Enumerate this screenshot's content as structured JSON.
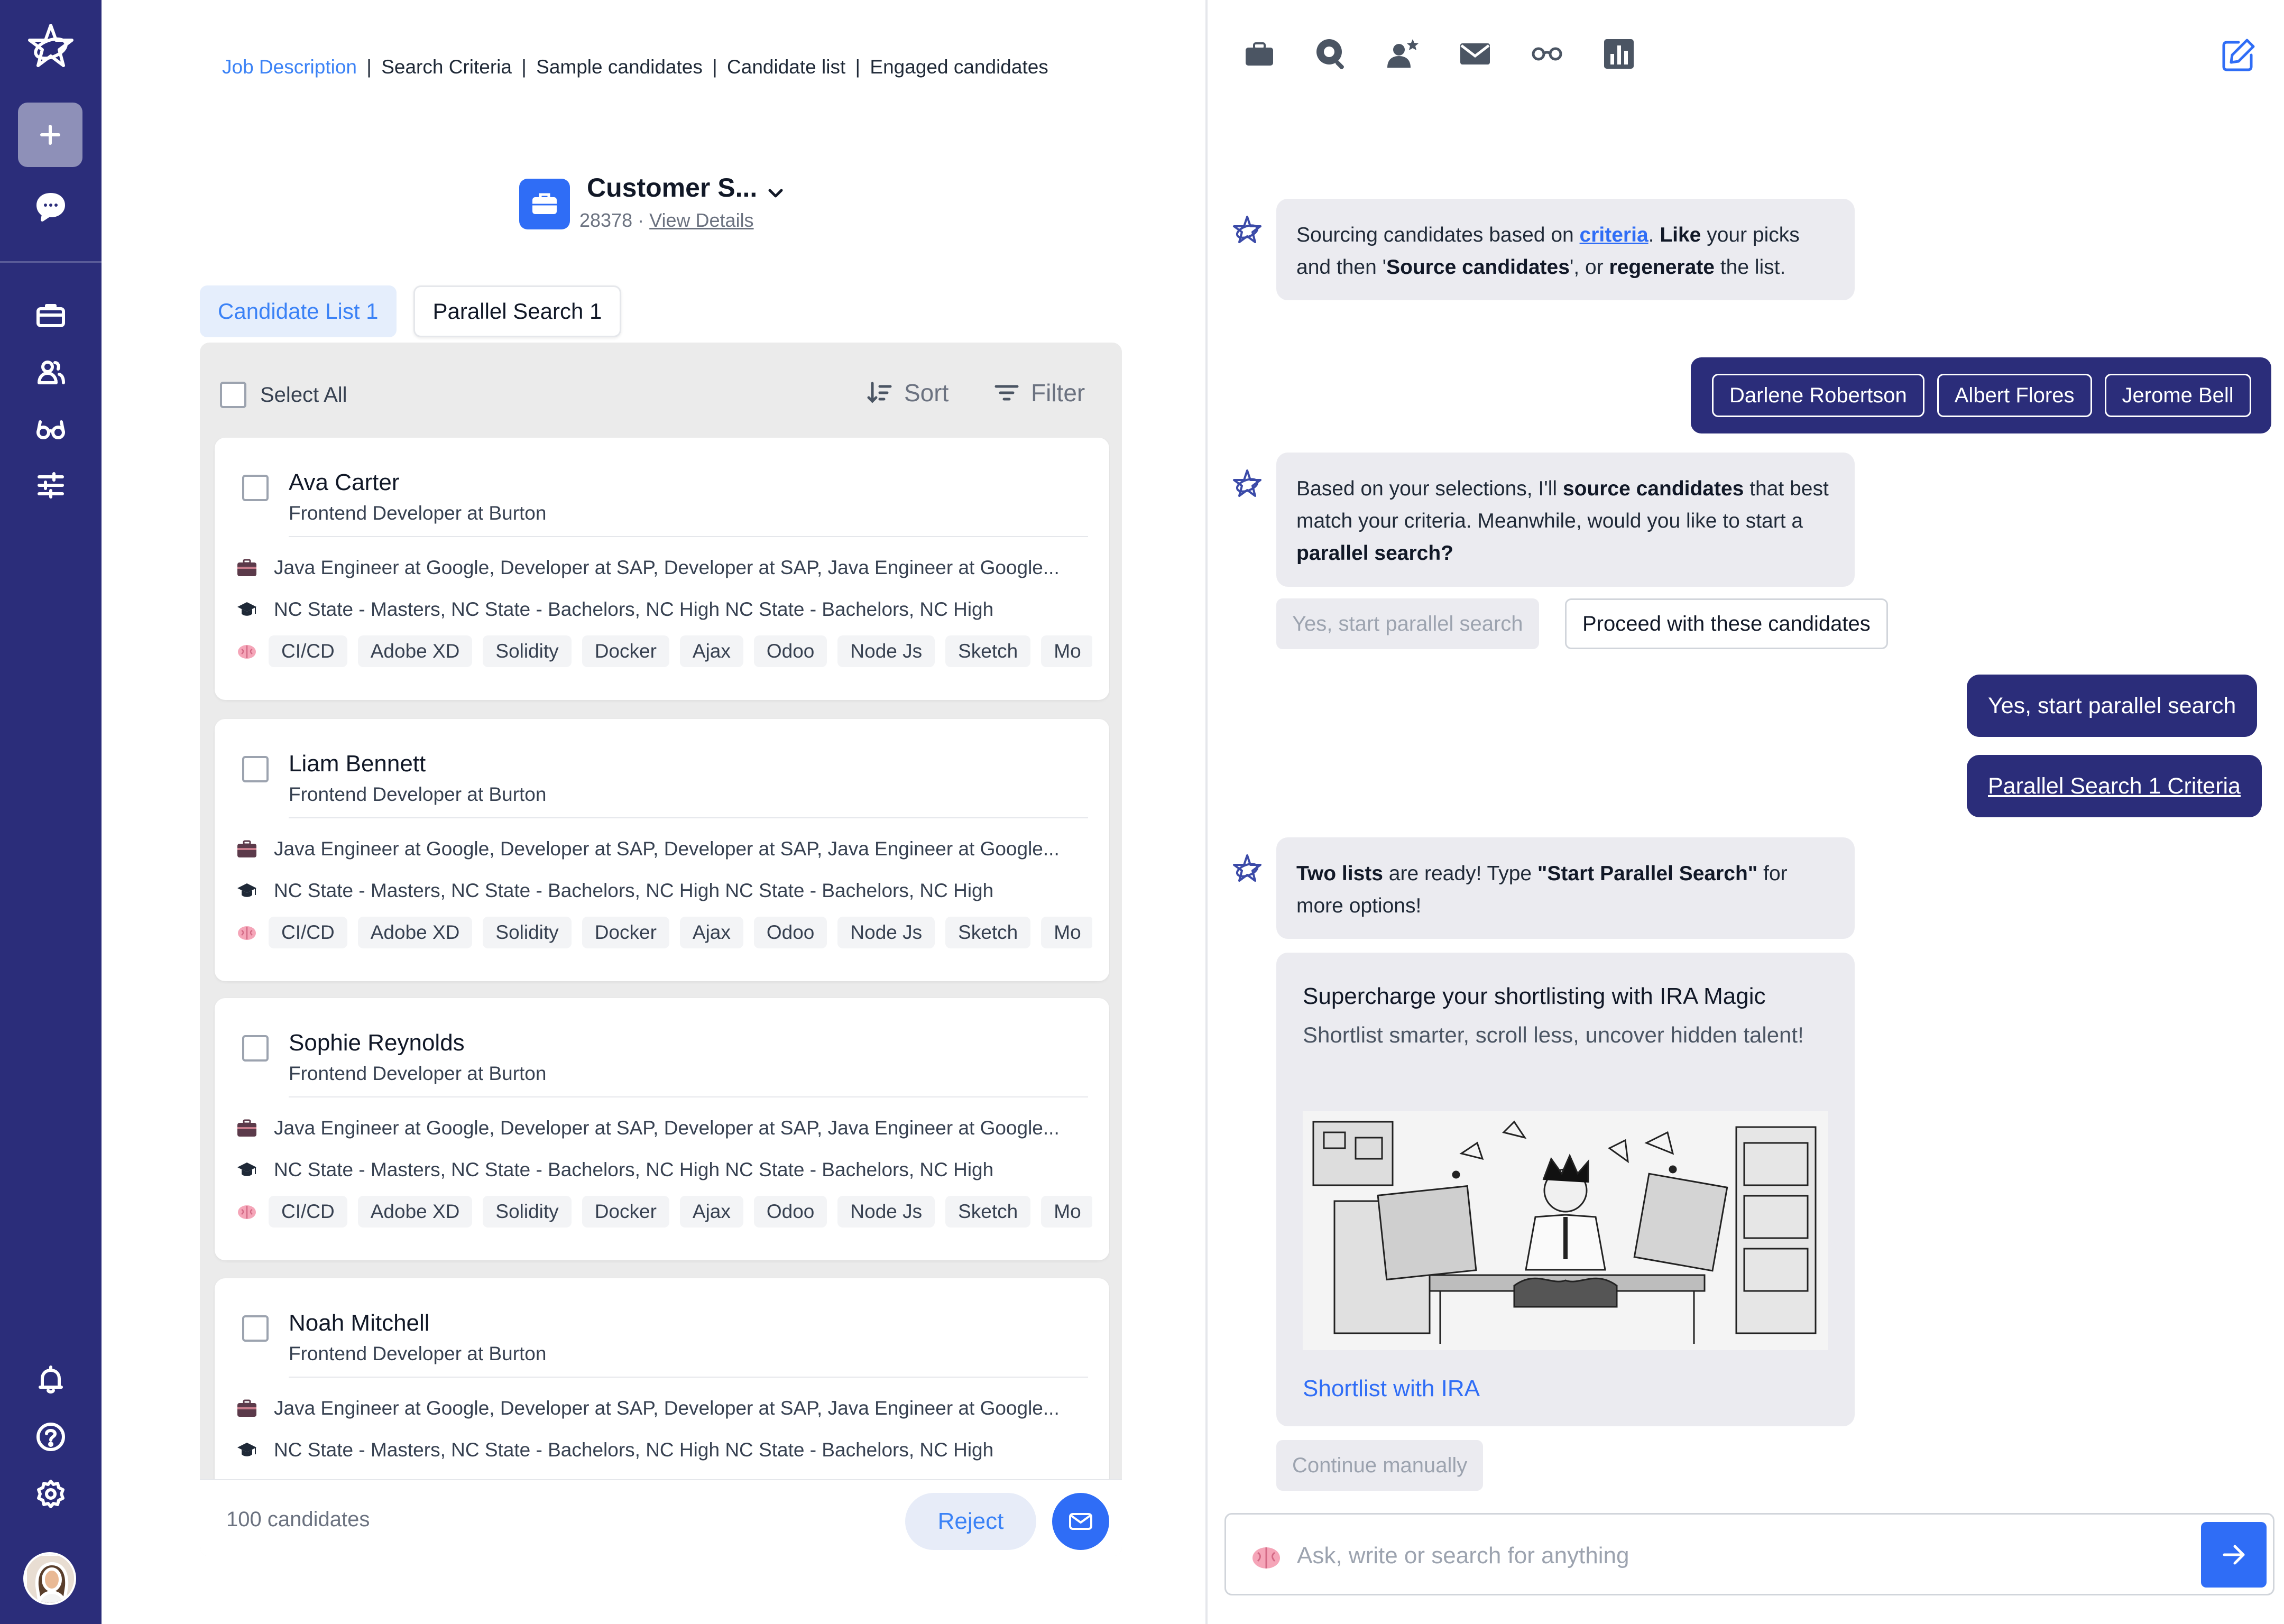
{
  "nav": {
    "items": [
      "logo-icon",
      "new-chat",
      "chat-icon",
      "briefcase-icon",
      "users-icon",
      "glasses-icon",
      "sliders-icon",
      "bell-icon",
      "help-icon",
      "settings-icon",
      "avatar"
    ]
  },
  "breadcrumb": {
    "items": [
      "Job Description",
      "Search Criteria",
      "Sample candidates",
      "Candidate list",
      "Engaged candidates"
    ],
    "active": "Job Description",
    "separator": "|"
  },
  "job": {
    "title": "Customer S...",
    "id": "28378",
    "dot": "·",
    "view_details": "View Details"
  },
  "tabs": {
    "list1": "Candidate List 1",
    "parallel1": "Parallel Search 1"
  },
  "list": {
    "select_all": "Select All",
    "sort": "Sort",
    "filter": "Filter",
    "candidates": [
      {
        "name": "Ava Carter",
        "role": "Frontend Developer at Burton",
        "experience": "Java Engineer at Google,  Developer at SAP,  Developer at SAP,  Java Engineer at Google...",
        "education": "NC State - Masters,  NC State - Bachelors,  NC High NC State - Bachelors,  NC High",
        "skills": [
          "CI/CD",
          "Adobe XD",
          "Solidity",
          "Docker",
          "Ajax",
          "Odoo",
          "Node Js",
          "Sketch",
          "Mo"
        ]
      },
      {
        "name": "Liam Bennett",
        "role": "Frontend Developer at Burton",
        "experience": "Java Engineer at Google,  Developer at SAP,  Developer at SAP,  Java Engineer at Google...",
        "education": "NC State - Masters,  NC State - Bachelors,  NC High NC State - Bachelors,  NC High",
        "skills": [
          "CI/CD",
          "Adobe XD",
          "Solidity",
          "Docker",
          "Ajax",
          "Odoo",
          "Node Js",
          "Sketch",
          "Mo"
        ]
      },
      {
        "name": "Sophie Reynolds",
        "role": "Frontend Developer at Burton",
        "experience": "Java Engineer at Google,  Developer at SAP,  Developer at SAP,  Java Engineer at Google...",
        "education": "NC State - Masters,  NC State - Bachelors,  NC High NC State - Bachelors,  NC High",
        "skills": [
          "CI/CD",
          "Adobe XD",
          "Solidity",
          "Docker",
          "Ajax",
          "Odoo",
          "Node Js",
          "Sketch",
          "Mo"
        ]
      },
      {
        "name": "Noah Mitchell",
        "role": "Frontend Developer at Burton",
        "experience": "Java Engineer at Google,  Developer at SAP,  Developer at SAP,  Java Engineer at Google...",
        "education": "NC State - Masters,  NC State - Bachelors,  NC High NC State - Bachelors,  NC High",
        "skills": []
      }
    ],
    "count": "100 candidates",
    "reject": "Reject"
  },
  "chat": {
    "toolbar": [
      "briefcase-icon",
      "search-icon",
      "user-star-icon",
      "mail-icon",
      "glasses-icon",
      "chart-icon"
    ],
    "msg1": {
      "pre": "Sourcing candidates based on ",
      "link": "criteria",
      "mid1": ". ",
      "bold1": "Like",
      "mid2": " your picks and then '",
      "bold2": "Source candidates",
      "mid3": "', or ",
      "bold3": "regenerate",
      "post": " the list."
    },
    "picks": [
      "Darlene Robertson",
      "Albert Flores",
      "Jerome Bell"
    ],
    "msg2": {
      "pre": "Based on your selections, I'll ",
      "bold1": "source candidates",
      "mid": " that best match your criteria. Meanwhile, would you like to start a ",
      "bold2": "parallel search?"
    },
    "opt_parallel": "Yes, start parallel search",
    "opt_proceed": "Proceed with these candidates",
    "user_reply": "Yes, start parallel search",
    "user_criteria": "Parallel Search 1 Criteria",
    "msg3": {
      "bold1": "Two lists",
      "mid": " are ready! Type ",
      "bold2": "\"Start Parallel Search\"",
      "post": " for more options!"
    },
    "promo": {
      "title": "Supercharge your shortlisting with IRA Magic",
      "subtitle": "Shortlist smarter, scroll less, uncover hidden talent!",
      "link": "Shortlist with IRA"
    },
    "continue": "Continue manually",
    "input_placeholder": "Ask, write or search for anything"
  },
  "colors": {
    "rail": "#2b2d7a",
    "accent": "#2f6df6",
    "bubble": "#ebebf0",
    "user_bubble": "#2b2d7a"
  }
}
